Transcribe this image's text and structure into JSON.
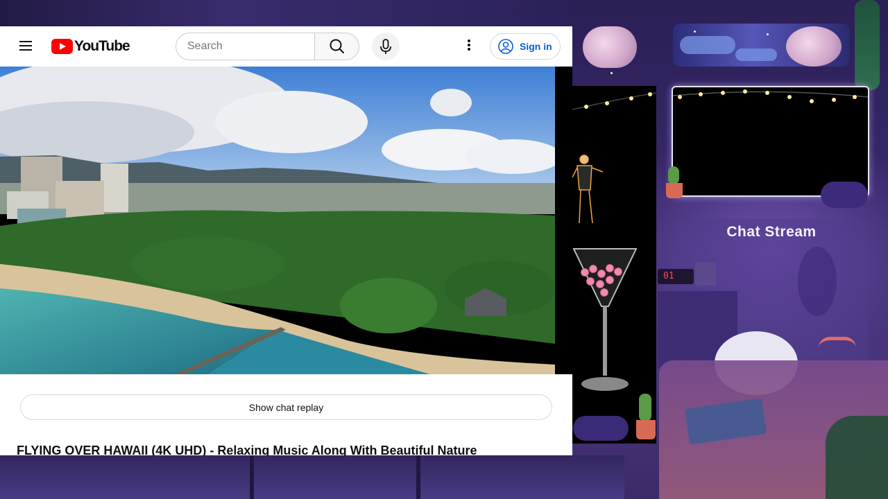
{
  "youtube": {
    "logo_text": "YouTube",
    "search_placeholder": "Search",
    "signin_label": "Sign in",
    "show_chat_replay_label": "Show chat replay",
    "video_title": "FLYING OVER HAWAII (4K UHD) - Relaxing Music Along With Beautiful Nature",
    "brand_color": "#ff0000",
    "link_color": "#065fd4"
  },
  "overlay": {
    "chat_title": "Chat Stream",
    "clock_text": "01"
  },
  "icons": [
    "menu-icon",
    "youtube-logo-icon",
    "search-icon",
    "mic-icon",
    "more-vert-icon",
    "account-circle-icon"
  ]
}
